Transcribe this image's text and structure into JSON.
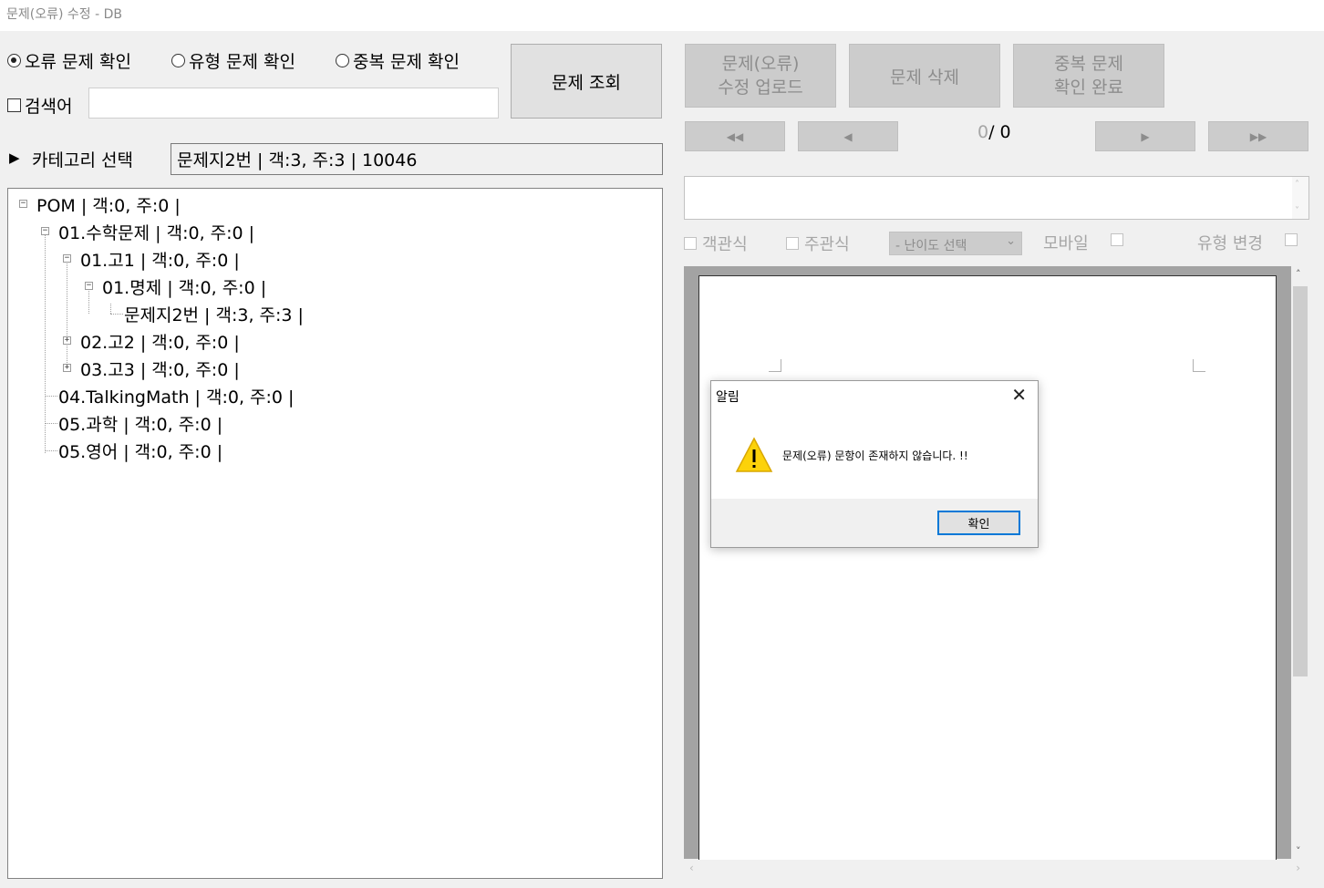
{
  "window": {
    "title": "문제(오류) 수정 - DB"
  },
  "modes": {
    "error_check": "오류 문제 확인",
    "type_check": "유형 문제 확인",
    "dup_check": "중복 문제 확인"
  },
  "search": {
    "label": "검색어",
    "value": ""
  },
  "buttons": {
    "query": "문제 조회",
    "upload_line1": "문제(오류)",
    "upload_line2": "수정 업로드",
    "delete": "문제 삭제",
    "dup_done_line1": "중복 문제",
    "dup_done_line2": "확인 완료"
  },
  "category": {
    "label": "카테고리 선택",
    "selected": "문제지2번 | 객:3, 주:3 | 10046"
  },
  "tree": {
    "n0": "POM | 객:0, 주:0 |",
    "n1": "01.수학문제 | 객:0, 주:0 |",
    "n2": "01.고1 | 객:0, 주:0 |",
    "n3": "01.명제 | 객:0, 주:0 |",
    "n4": "문제지2번 | 객:3, 주:3 |",
    "n5": "02.고2 | 객:0, 주:0 |",
    "n6": "03.고3 | 객:0, 주:0 |",
    "n7": "04.TalkingMath | 객:0, 주:0 |",
    "n8": "05.과학 | 객:0, 주:0 |",
    "n9": "05.영어 | 객:0, 주:0 |"
  },
  "pager": {
    "current": "0",
    "sep": "/",
    "total": "0",
    "first": "◀◀",
    "prev": "◀",
    "next": "▶",
    "last": "▶▶"
  },
  "options": {
    "objective": "객관식",
    "subjective": "주관식",
    "difficulty": "- 난이도 선택",
    "mobile": "모바일",
    "type_change": "유형 변경"
  },
  "dialog": {
    "title": "알림",
    "message": "문제(오류) 문항이 존재하지 않습니다. !!",
    "ok": "확인"
  }
}
